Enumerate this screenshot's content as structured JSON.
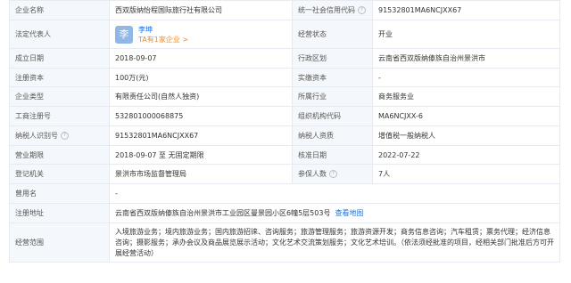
{
  "rows": {
    "company_name_label": "企业名称",
    "company_name": "西双版纳怡程国际旅行社有限公司",
    "credit_code_label": "统一社会信用代码",
    "credit_code": "91532801MA6NCJXX67",
    "legal_rep_label": "法定代表人",
    "legal_rep_avatar": "李",
    "legal_rep_name": "李坤",
    "legal_rep_sub": "TA有1家企业 >",
    "status_label": "经营状态",
    "status": "开业",
    "founded_label": "成立日期",
    "founded": "2018-09-07",
    "region_label": "行政区划",
    "region": "云南省西双版纳傣族自治州景洪市",
    "reg_capital_label": "注册资本",
    "reg_capital": "100万(元)",
    "paid_capital_label": "实缴资本",
    "paid_capital": "-",
    "company_type_label": "企业类型",
    "company_type": "有限责任公司(自然人独资)",
    "industry_label": "所属行业",
    "industry": "商务服务业",
    "reg_number_label": "工商注册号",
    "reg_number": "532801000068875",
    "org_code_label": "组织机构代码",
    "org_code": "MA6NCJXX-6",
    "taxpayer_id_label": "纳税人识别号",
    "taxpayer_id": "91532801MA6NCJXX67",
    "taxpayer_qual_label": "纳税人资质",
    "taxpayer_qual": "增值税一般纳税人",
    "term_label": "营业期限",
    "term": "2018-09-07 至 无固定期限",
    "approval_date_label": "核准日期",
    "approval_date": "2022-07-22",
    "authority_label": "登记机关",
    "authority": "景洪市市场监督管理局",
    "insured_label": "参保人数",
    "insured": "7人",
    "former_name_label": "曾用名",
    "former_name": "-",
    "address_label": "注册地址",
    "address": "云南省西双版纳傣族自治州景洪市工业园区曼景园小区6幢5层503号",
    "address_link": "查看地图",
    "scope_label": "经营范围",
    "scope": "入境旅游业务；境内旅游业务；国内旅游招徕、咨询服务；旅游管理服务；旅游资源开发；商务信息咨询；汽车租赁；票务代理；经济信息咨询；摄影服务；承办会议及商品展览展示活动；文化艺术交流策划服务；文化艺术培训。（依法须经批准的项目，经相关部门批准后方可开展经营活动）"
  },
  "icons": {
    "help": "question-circle-icon"
  },
  "colors": {
    "label_bg": "#f4f7fb",
    "border": "#e6ebf2",
    "link": "#1e6fd9",
    "accent_orange": "#f08a24"
  }
}
